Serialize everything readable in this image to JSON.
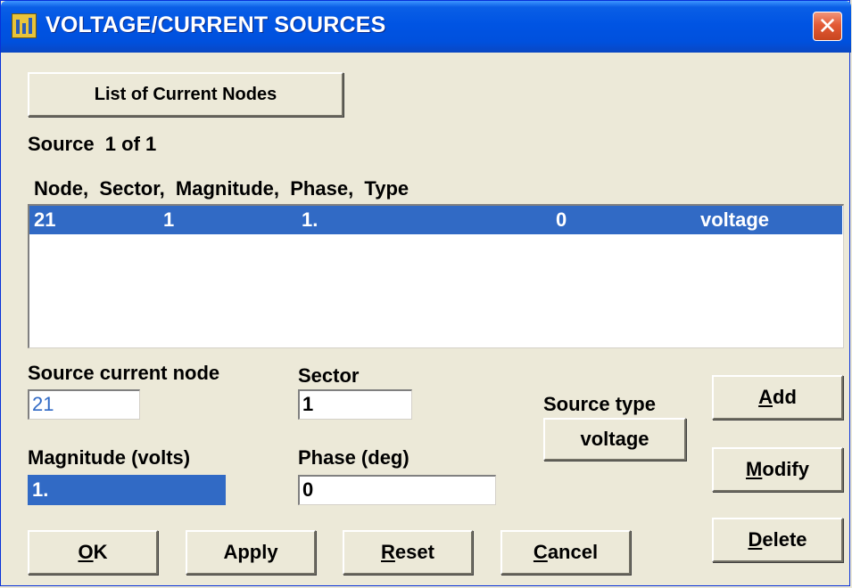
{
  "window": {
    "title": "VOLTAGE/CURRENT SOURCES",
    "close_glyph": "✕",
    "icon": "app-icon"
  },
  "toolbar": {
    "list_nodes_label": "List of Current Nodes"
  },
  "source_counter": "Source  1 of 1",
  "list": {
    "header": "Node,  Sector,  Magnitude,  Phase,  Type",
    "rows": [
      {
        "node": "21",
        "sector": "1",
        "magnitude": "1.",
        "phase": "0",
        "type": "voltage"
      }
    ]
  },
  "form": {
    "source_node_label": "Source current node",
    "source_node_value": "21",
    "sector_label": "Sector",
    "sector_value": "1",
    "magnitude_label": "Magnitude (volts)",
    "magnitude_value": "1.",
    "phase_label": "Phase (deg)",
    "phase_value": "0",
    "source_type_label": "Source type",
    "source_type_value": "voltage"
  },
  "side_buttons": {
    "add_prefix": "",
    "add_mnemonic": "A",
    "add_rest": "dd",
    "modify_mnemonic": "M",
    "modify_rest": "odify",
    "delete_mnemonic": "D",
    "delete_rest": "elete"
  },
  "bottom_buttons": {
    "ok_mnemonic": "O",
    "ok_rest": "K",
    "apply_label": "Apply",
    "reset_mnemonic": "R",
    "reset_rest": "eset",
    "cancel_mnemonic": "C",
    "cancel_rest": "ancel"
  },
  "colors": {
    "titlebar": "#0054e3",
    "selection": "#316ac5",
    "dialog_bg": "#ece9d8"
  }
}
